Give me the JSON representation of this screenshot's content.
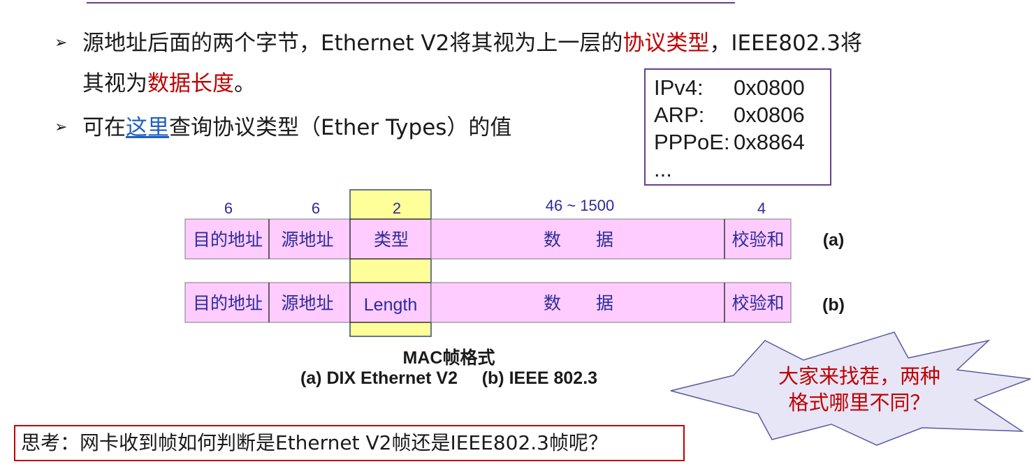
{
  "bullets": {
    "b1_pre": "源地址后面的两个字节，Ethernet V2将其视为上一层的",
    "b1_red": "协议类型",
    "b1_post": "，IEEE802.3将",
    "b1_line2_pre": "其视为",
    "b1_line2_red": "数据长度",
    "b1_line2_post": "。",
    "b2_pre": "可在",
    "b2_link": "这里",
    "b2_post": "查询协议类型（Ether Types）的值",
    "arrow": "➢"
  },
  "ether_types": [
    {
      "name": "IPv4:",
      "value": "0x0800"
    },
    {
      "name": "ARP:",
      "value": "0x0806"
    },
    {
      "name": "PPPoE:",
      "value": "0x8864"
    },
    {
      "name": "...",
      "value": ""
    }
  ],
  "frame": {
    "sizes": [
      "6",
      "6",
      "2",
      "46 ~ 1500",
      "4"
    ],
    "row_a": {
      "fields": [
        "目的地址",
        "源地址",
        "类型",
        "数　　据",
        "校验和"
      ],
      "label": "(a)"
    },
    "row_b": {
      "fields": [
        "目的地址",
        "源地址",
        "Length",
        "数　　据",
        "校验和"
      ],
      "label": "(b)"
    },
    "caption_title": "MAC帧格式",
    "caption_sub": "(a) DIX Ethernet V2     (b) IEEE 802.3",
    "colors": {
      "field_fill": "#ffccff",
      "highlight": "#ffff99",
      "text": "#2b2b9b"
    }
  },
  "think": "思考：网卡收到帧如何判断是Ethernet V2帧还是IEEE802.3帧呢？",
  "callout": {
    "line1": "大家来找茬，两种",
    "line2": "格式哪里不同？",
    "fill": "#e6e6f7",
    "stroke": "#5a5aa0"
  }
}
